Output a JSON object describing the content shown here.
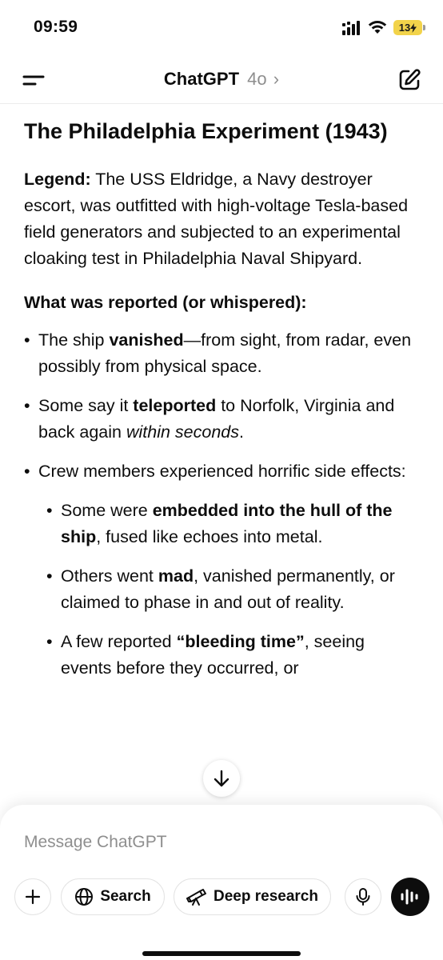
{
  "status": {
    "time": "09:59",
    "battery": "13"
  },
  "header": {
    "title": "ChatGPT",
    "model": "4o",
    "chevron": "›"
  },
  "article": {
    "heading": "The Philadelphia Experiment (1943)",
    "legend_label": "Legend:",
    "legend_text": " The USS Eldridge, a Navy destroyer escort, was outfitted with high-voltage Tesla-based field generators and subjected to an experimental cloaking test in Philadelphia Naval Shipyard.",
    "section_heading": "What was reported (or whispered):",
    "bullets": [
      {
        "pre": "The ship ",
        "bold": "vanished",
        "post": "—from sight, from radar, even possibly from physical space."
      },
      {
        "pre": "Some say it ",
        "bold": "teleported",
        "mid": " to Norfolk, Virginia and back again ",
        "italic": "within seconds",
        "post": "."
      },
      {
        "text": "Crew members experienced horrific side effects:"
      }
    ],
    "sub_bullets": [
      {
        "pre": "Some were ",
        "bold": "embedded into the hull of the ship",
        "post": ", fused like echoes into metal."
      },
      {
        "pre": "Others went ",
        "bold": "mad",
        "post": ", vanished permanently, or claimed to phase in and out of reality."
      },
      {
        "pre": "A few reported ",
        "bold": "“bleeding time”",
        "post": ", seeing events before they occurred, or"
      }
    ]
  },
  "composer": {
    "placeholder": "Message ChatGPT",
    "search_label": "Search",
    "research_label": "Deep research"
  },
  "icons": {
    "menu": "menu-icon",
    "new_chat": "new-chat-icon",
    "scroll": "arrow-down-icon",
    "plus": "plus-icon",
    "globe": "globe-icon",
    "telescope": "telescope-icon",
    "mic": "microphone-icon",
    "voice": "voice-waveform-icon"
  }
}
